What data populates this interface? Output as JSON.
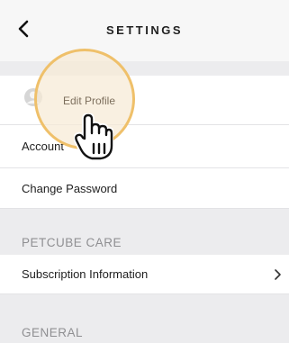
{
  "header": {
    "title": "SETTINGS"
  },
  "profile": {
    "edit_profile_label": "Edit Profile",
    "account_label": "Account",
    "change_password_label": "Change Password"
  },
  "petcube_care": {
    "section_title": "PETCUBE CARE",
    "subscription_label": "Subscription Information"
  },
  "general": {
    "section_title": "GENERAL"
  },
  "icons": {
    "back": "back-chevron-icon",
    "avatar": "profile-avatar-icon",
    "row_chevron": "chevron-right-icon",
    "pointer": "hand-pointer-icon"
  },
  "colors": {
    "highlight_ring": "#efc06a",
    "highlight_fill": "#f7ead6",
    "section_text": "#8f8f92"
  }
}
